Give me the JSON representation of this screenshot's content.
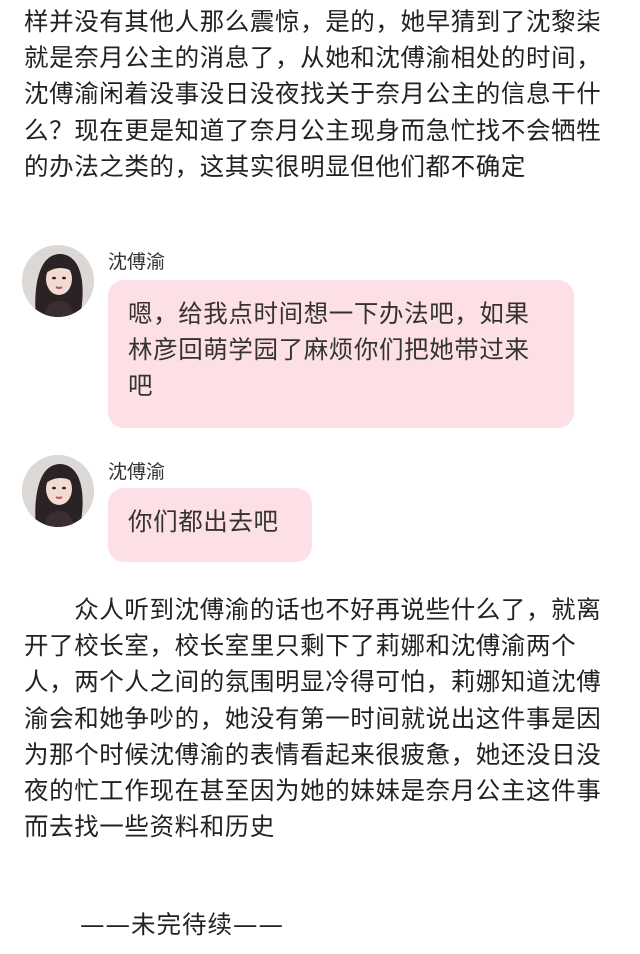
{
  "paragraphs": {
    "top": "样并没有其他人那么震惊，是的，她早猜到了沈黎柒就是奈月公主的消息了，从她和沈傅渝相处的时间，沈傅渝闲着没事没日没夜找关于奈月公主的信息干什么？现在更是知道了奈月公主现身而急忙找不会牺牲的办法之类的，这其实很明显但他们都不确定",
    "bottom": "　　众人听到沈傅渝的话也不好再说些什么了，就离开了校长室，校长室里只剩下了莉娜和沈傅渝两个人，两个人之间的氛围明显冷得可怕，莉娜知道沈傅渝会和她争吵的，她没有第一时间就说出这件事是因为那个时候沈傅渝的表情看起来很疲惫，她还没日没夜的忙工作现在甚至因为她的妹妹是奈月公主这件事而去找一些资料和历史"
  },
  "messages": [
    {
      "speaker": "沈傅渝",
      "text": "嗯，给我点时间想一下办法吧，如果林彦回萌学园了麻烦你们把她带过来吧"
    },
    {
      "speaker": "沈傅渝",
      "text": "你们都出去吧"
    }
  ],
  "footer": {
    "end_text": "——未完待续——"
  },
  "colors": {
    "bubble_background": "#fde0e5",
    "text": "#222222"
  }
}
